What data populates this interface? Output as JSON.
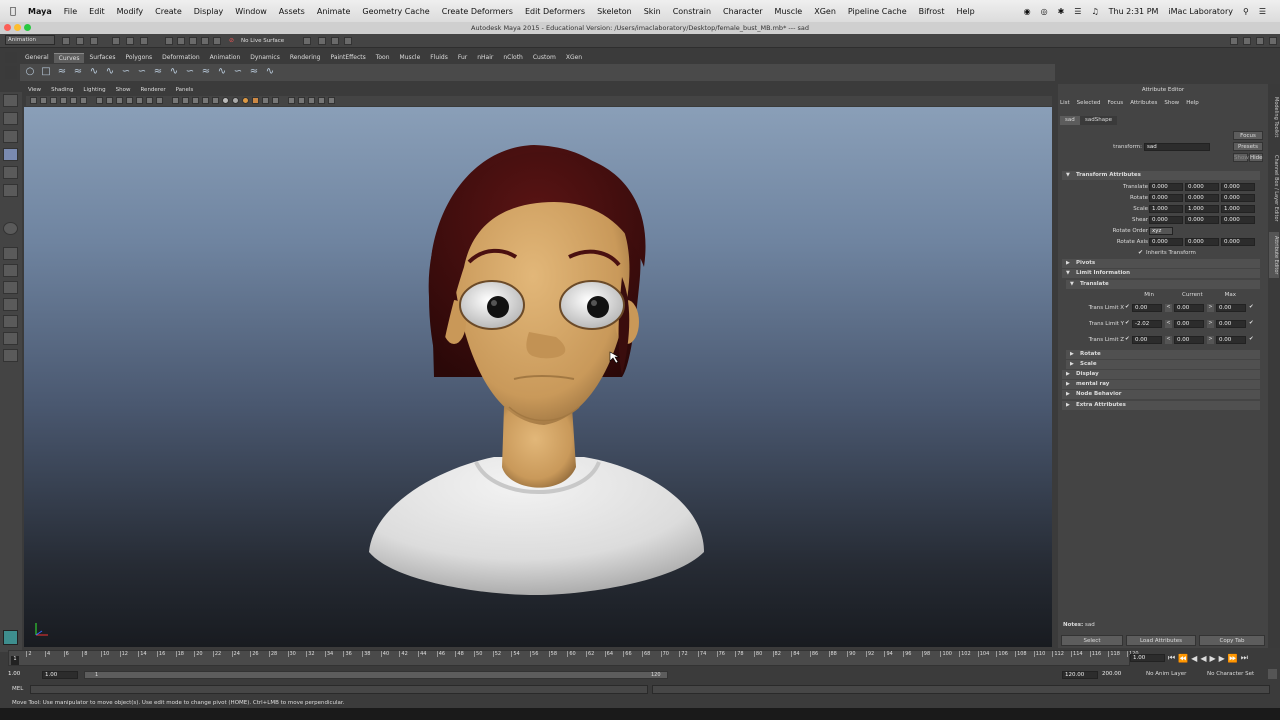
{
  "mac_menu": {
    "apple": "",
    "app": "Maya",
    "items": [
      "File",
      "Edit",
      "Modify",
      "Create",
      "Display",
      "Window",
      "Assets",
      "Animate",
      "Geometry Cache",
      "Create Deformers",
      "Edit Deformers",
      "Skeleton",
      "Skin",
      "Constrain",
      "Character",
      "Muscle",
      "XGen",
      "Pipeline Cache",
      "Bifrost",
      "Help"
    ],
    "clock": "Thu 2:31 PM",
    "user": "iMac Laboratory"
  },
  "title_bar": "Autodesk Maya 2015 - Educational Version: /Users/imaclaboratory/Desktop/female_bust_MB.mb* --- sad",
  "status_line": {
    "mode_menu": "Animation",
    "live_surface": "No Live Surface"
  },
  "shelf": {
    "tabs": [
      "General",
      "Curves",
      "Surfaces",
      "Polygons",
      "Deformation",
      "Animation",
      "Dynamics",
      "Rendering",
      "PaintEffects",
      "Toon",
      "Muscle",
      "Fluids",
      "Fur",
      "nHair",
      "nCloth",
      "Custom",
      "XGen"
    ],
    "active_tab": "Curves"
  },
  "panel_menu": [
    "View",
    "Shading",
    "Lighting",
    "Show",
    "Renderer",
    "Panels"
  ],
  "attribute_editor": {
    "title": "Attribute Editor",
    "menu": [
      "List",
      "Selected",
      "Focus",
      "Attributes",
      "Show",
      "Help"
    ],
    "node_tabs": [
      "sad",
      "sadShape"
    ],
    "transform_label": "transform:",
    "transform_value": "sad",
    "focus_btn": "Focus",
    "presets_btn": "Presets",
    "show_btn": "Show",
    "hide_btn": "Hide",
    "transform_section": "Transform Attributes",
    "translate": {
      "label": "Translate",
      "x": "0.000",
      "y": "0.000",
      "z": "0.000"
    },
    "rotate": {
      "label": "Rotate",
      "x": "0.000",
      "y": "0.000",
      "z": "0.000"
    },
    "scale": {
      "label": "Scale",
      "x": "1.000",
      "y": "1.000",
      "z": "1.000"
    },
    "shear": {
      "label": "Shear",
      "x": "0.000",
      "y": "0.000",
      "z": "0.000"
    },
    "rotate_order_label": "Rotate Order",
    "rotate_order_value": "xyz",
    "rotate_axis": {
      "label": "Rotate Axis",
      "x": "0.000",
      "y": "0.000",
      "z": "0.000"
    },
    "inherits_transform": "Inherits Transform",
    "pivots": "Pivots",
    "limit_information": "Limit Information",
    "translate_section": "Translate",
    "col_min": "Min",
    "col_current": "Current",
    "col_max": "Max",
    "limits": [
      {
        "label": "Trans Limit X",
        "min": "0.00",
        "current": "0.00",
        "max": "0.00"
      },
      {
        "label": "Trans Limit Y",
        "min": "-2.02",
        "current": "0.00",
        "max": "0.00"
      },
      {
        "label": "Trans Limit Z",
        "min": "0.00",
        "current": "0.00",
        "max": "0.00"
      }
    ],
    "collapsed_sections": [
      "Rotate",
      "Scale",
      "Display",
      "mental ray",
      "Node Behavior",
      "Extra Attributes"
    ],
    "notes_label": "Notes:",
    "notes_value": "sad",
    "select_btn": "Select",
    "load_attributes_btn": "Load Attributes",
    "copy_tab_btn": "Copy Tab"
  },
  "side_tabs": [
    "Modeling Toolkit",
    "Channel Box / Layer Editor",
    "Attribute Editor"
  ],
  "time_slider": {
    "ticks": [
      "1",
      "2",
      "4",
      "6",
      "8",
      "10",
      "12",
      "14",
      "16",
      "18",
      "20",
      "22",
      "24",
      "26",
      "28",
      "30",
      "32",
      "34",
      "36",
      "38",
      "40",
      "42",
      "44",
      "46",
      "48",
      "50",
      "52",
      "54",
      "56",
      "58",
      "60",
      "62",
      "64",
      "66",
      "68",
      "70",
      "72",
      "74",
      "76",
      "78",
      "80",
      "82",
      "84",
      "86",
      "88",
      "90",
      "92",
      "94",
      "96",
      "98",
      "100",
      "102",
      "104",
      "106",
      "108",
      "110",
      "112",
      "114",
      "116",
      "118",
      "120"
    ],
    "current_frame": "1.00"
  },
  "range_slider": {
    "start": "1.00",
    "start_inner": "1.00",
    "range_start_label": "1",
    "range_end_label": "120",
    "end_inner": "120.00",
    "end": "200.00",
    "anim_layer": "No Anim Layer",
    "character_set": "No Character Set"
  },
  "command_line": {
    "label": "MEL"
  },
  "help_line": "Move Tool: Use manipulator to move object(s). Use edit mode to change pivot (HOME). Ctrl+LMB to move perpendicular.",
  "colors": {
    "skin": "#d6a96a",
    "hair": "#3a0d0d",
    "shirt": "#e6e6e6",
    "ui_bg": "#444444"
  }
}
